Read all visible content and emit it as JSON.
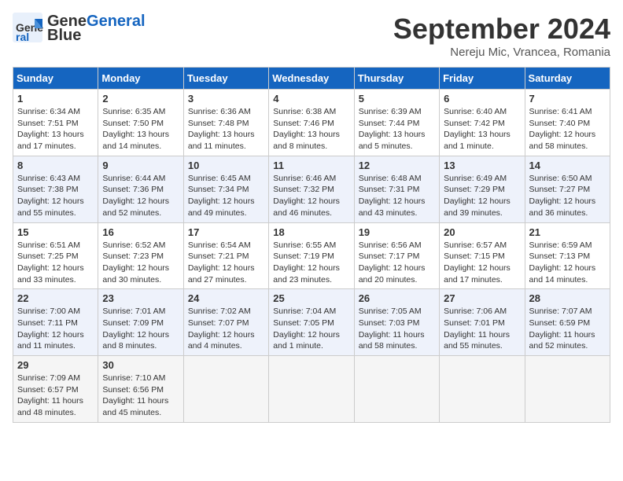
{
  "header": {
    "logo_general": "General",
    "logo_blue": "Blue",
    "month_title": "September 2024",
    "subtitle": "Nereju Mic, Vrancea, Romania"
  },
  "days_of_week": [
    "Sunday",
    "Monday",
    "Tuesday",
    "Wednesday",
    "Thursday",
    "Friday",
    "Saturday"
  ],
  "weeks": [
    [
      {
        "day": "1",
        "sunrise": "6:34 AM",
        "sunset": "7:51 PM",
        "daylight": "13 hours and 17 minutes."
      },
      {
        "day": "2",
        "sunrise": "6:35 AM",
        "sunset": "7:50 PM",
        "daylight": "13 hours and 14 minutes."
      },
      {
        "day": "3",
        "sunrise": "6:36 AM",
        "sunset": "7:48 PM",
        "daylight": "13 hours and 11 minutes."
      },
      {
        "day": "4",
        "sunrise": "6:38 AM",
        "sunset": "7:46 PM",
        "daylight": "13 hours and 8 minutes."
      },
      {
        "day": "5",
        "sunrise": "6:39 AM",
        "sunset": "7:44 PM",
        "daylight": "13 hours and 5 minutes."
      },
      {
        "day": "6",
        "sunrise": "6:40 AM",
        "sunset": "7:42 PM",
        "daylight": "13 hours and 1 minute."
      },
      {
        "day": "7",
        "sunrise": "6:41 AM",
        "sunset": "7:40 PM",
        "daylight": "12 hours and 58 minutes."
      }
    ],
    [
      {
        "day": "8",
        "sunrise": "6:43 AM",
        "sunset": "7:38 PM",
        "daylight": "12 hours and 55 minutes."
      },
      {
        "day": "9",
        "sunrise": "6:44 AM",
        "sunset": "7:36 PM",
        "daylight": "12 hours and 52 minutes."
      },
      {
        "day": "10",
        "sunrise": "6:45 AM",
        "sunset": "7:34 PM",
        "daylight": "12 hours and 49 minutes."
      },
      {
        "day": "11",
        "sunrise": "6:46 AM",
        "sunset": "7:32 PM",
        "daylight": "12 hours and 46 minutes."
      },
      {
        "day": "12",
        "sunrise": "6:48 AM",
        "sunset": "7:31 PM",
        "daylight": "12 hours and 43 minutes."
      },
      {
        "day": "13",
        "sunrise": "6:49 AM",
        "sunset": "7:29 PM",
        "daylight": "12 hours and 39 minutes."
      },
      {
        "day": "14",
        "sunrise": "6:50 AM",
        "sunset": "7:27 PM",
        "daylight": "12 hours and 36 minutes."
      }
    ],
    [
      {
        "day": "15",
        "sunrise": "6:51 AM",
        "sunset": "7:25 PM",
        "daylight": "12 hours and 33 minutes."
      },
      {
        "day": "16",
        "sunrise": "6:52 AM",
        "sunset": "7:23 PM",
        "daylight": "12 hours and 30 minutes."
      },
      {
        "day": "17",
        "sunrise": "6:54 AM",
        "sunset": "7:21 PM",
        "daylight": "12 hours and 27 minutes."
      },
      {
        "day": "18",
        "sunrise": "6:55 AM",
        "sunset": "7:19 PM",
        "daylight": "12 hours and 23 minutes."
      },
      {
        "day": "19",
        "sunrise": "6:56 AM",
        "sunset": "7:17 PM",
        "daylight": "12 hours and 20 minutes."
      },
      {
        "day": "20",
        "sunrise": "6:57 AM",
        "sunset": "7:15 PM",
        "daylight": "12 hours and 17 minutes."
      },
      {
        "day": "21",
        "sunrise": "6:59 AM",
        "sunset": "7:13 PM",
        "daylight": "12 hours and 14 minutes."
      }
    ],
    [
      {
        "day": "22",
        "sunrise": "7:00 AM",
        "sunset": "7:11 PM",
        "daylight": "12 hours and 11 minutes."
      },
      {
        "day": "23",
        "sunrise": "7:01 AM",
        "sunset": "7:09 PM",
        "daylight": "12 hours and 8 minutes."
      },
      {
        "day": "24",
        "sunrise": "7:02 AM",
        "sunset": "7:07 PM",
        "daylight": "12 hours and 4 minutes."
      },
      {
        "day": "25",
        "sunrise": "7:04 AM",
        "sunset": "7:05 PM",
        "daylight": "12 hours and 1 minute."
      },
      {
        "day": "26",
        "sunrise": "7:05 AM",
        "sunset": "7:03 PM",
        "daylight": "11 hours and 58 minutes."
      },
      {
        "day": "27",
        "sunrise": "7:06 AM",
        "sunset": "7:01 PM",
        "daylight": "11 hours and 55 minutes."
      },
      {
        "day": "28",
        "sunrise": "7:07 AM",
        "sunset": "6:59 PM",
        "daylight": "11 hours and 52 minutes."
      }
    ],
    [
      {
        "day": "29",
        "sunrise": "7:09 AM",
        "sunset": "6:57 PM",
        "daylight": "11 hours and 48 minutes."
      },
      {
        "day": "30",
        "sunrise": "7:10 AM",
        "sunset": "6:56 PM",
        "daylight": "11 hours and 45 minutes."
      },
      null,
      null,
      null,
      null,
      null
    ]
  ]
}
